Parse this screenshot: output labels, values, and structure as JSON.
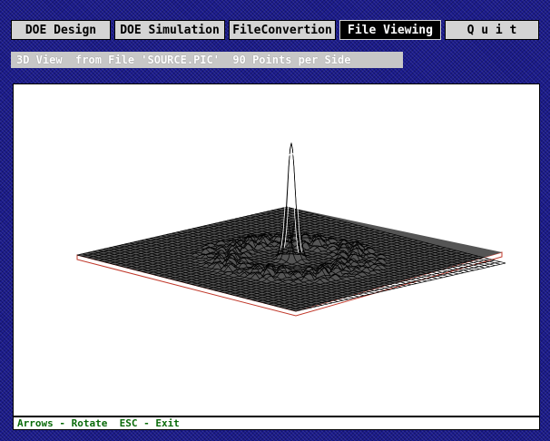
{
  "menu": {
    "items": [
      {
        "label": "DOE Design"
      },
      {
        "label": "DOE Simulation"
      },
      {
        "label": "FileConvertion"
      },
      {
        "label": "File Viewing",
        "active": true
      },
      {
        "label": "Q u i t"
      }
    ]
  },
  "view": {
    "title": "3D View  from File 'SOURCE.PIC'  90 Points per Side"
  },
  "status": {
    "hint": "Arrows - Rotate  ESC - Exit"
  },
  "colors": {
    "background": "#1a1a8c",
    "menu_bg": "#d4d4d4",
    "active_menu_bg": "#000000",
    "plate_edge": "#c0392b",
    "status_text": "#0a6b0a"
  }
}
